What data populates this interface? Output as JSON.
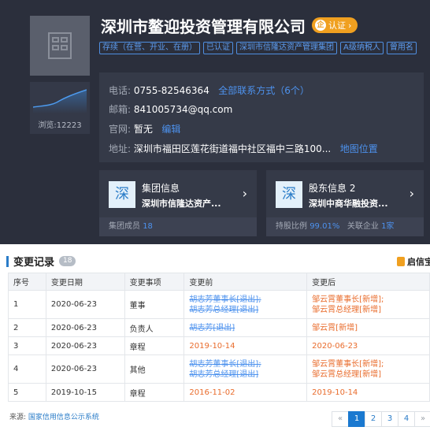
{
  "company": {
    "name": "深圳市鳌迎投资管理有限公司",
    "cert_label": "认证",
    "cert_badge": "企",
    "tags": [
      "存续（在营、开业、在册）",
      "已认证",
      "深圳市信隆达资产管理集团",
      "A级纳税人",
      "曾用名"
    ],
    "views": "浏览:12223"
  },
  "contact": {
    "phone_label": "电话:",
    "phone": "0755-82546364",
    "phone_link": "全部联系方式（6个）",
    "email_label": "邮箱:",
    "email": "841005734@qq.com",
    "site_label": "官网:",
    "site": "暂无",
    "site_edit": "编辑",
    "addr_label": "地址:",
    "addr": "深圳市福田区莲花街道福中社区福中三路100...",
    "addr_link": "地图位置"
  },
  "group_card": {
    "icon_char": "深",
    "title": "集团信息",
    "subtitle": "深圳市信隆达资产...",
    "foot_label": "集团成员",
    "foot_value": "18"
  },
  "shareholder_card": {
    "icon_char": "深",
    "title": "股东信息 2",
    "subtitle": "深圳中商华融投资...",
    "foot_label1": "持股比例",
    "foot_value1": "99.01%",
    "foot_label2": "关联企业",
    "foot_value2": "1家"
  },
  "changes": {
    "title": "变更记录",
    "count": "18",
    "brand": "启信宝",
    "headers": [
      "序号",
      "变更日期",
      "变更事项",
      "变更前",
      "变更后"
    ],
    "rows": [
      {
        "no": "1",
        "date": "2020-06-23",
        "item": "董事",
        "before": [
          "胡志芳董事长[退出];",
          "胡志芳总经理[退出]"
        ],
        "after": [
          "邹云霄董事长[新增];",
          "邹云霄总经理[新增]"
        ]
      },
      {
        "no": "2",
        "date": "2020-06-23",
        "item": "负责人",
        "before": [
          "胡志芳[退出]"
        ],
        "after": [
          "邹云霄[新增]"
        ]
      },
      {
        "no": "3",
        "date": "2020-06-23",
        "item": "章程",
        "before": [
          "2019-10-14"
        ],
        "after": [
          "2020-06-23"
        ]
      },
      {
        "no": "4",
        "date": "2020-06-23",
        "item": "其他",
        "before": [
          "胡志芳董事长[退出];",
          "胡志芳总经理[退出]"
        ],
        "after": [
          "邹云霄董事长[新增];",
          "邹云霄总经理[新增]"
        ]
      },
      {
        "no": "5",
        "date": "2019-10-15",
        "item": "章程",
        "before": [
          "2016-11-02"
        ],
        "after": [
          "2019-10-14"
        ]
      }
    ]
  },
  "source": {
    "label": "来源:",
    "link": "国家信用信息公示系统"
  },
  "pager": [
    "«",
    "1",
    "2",
    "3",
    "4",
    "»"
  ]
}
